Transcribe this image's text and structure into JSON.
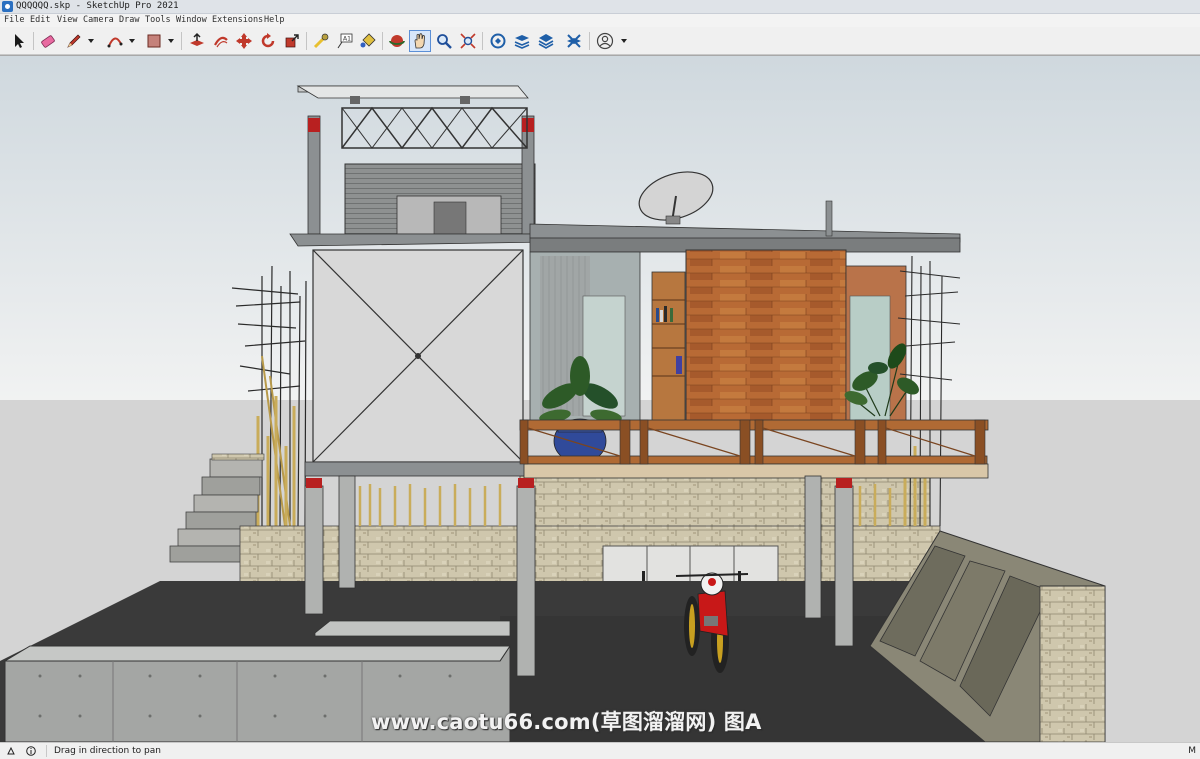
{
  "window": {
    "title": "QQQQQQ.skp - SketchUp Pro 2021"
  },
  "menu": [
    "File",
    "Edit",
    "View",
    "Camera",
    "Draw",
    "Tools",
    "Window",
    "Extensions",
    "Help"
  ],
  "toolbar": {
    "tools": [
      {
        "name": "select-tool"
      },
      {
        "name": "eraser-tool"
      },
      {
        "name": "line-tool",
        "dropdown": true
      },
      {
        "name": "arc-tool",
        "dropdown": true
      },
      {
        "name": "rectangle-tool",
        "dropdown": true
      },
      {
        "name": "push-pull-tool"
      },
      {
        "name": "offset-tool"
      },
      {
        "name": "move-tool"
      },
      {
        "name": "rotate-tool"
      },
      {
        "name": "scale-tool"
      },
      {
        "name": "tape-measure-tool"
      },
      {
        "name": "text-tool"
      },
      {
        "name": "paint-bucket-tool"
      },
      {
        "name": "orbit-tool"
      },
      {
        "name": "pan-tool",
        "active": true
      },
      {
        "name": "zoom-tool"
      },
      {
        "name": "zoom-extents-tool"
      },
      {
        "name": "warehouse-tool"
      },
      {
        "name": "extension-warehouse-tool"
      },
      {
        "name": "layout-send-tool"
      },
      {
        "name": "extension-manager-tool"
      },
      {
        "name": "account-tool",
        "dropdown": true
      }
    ]
  },
  "viewport": {
    "watermark": "www.caotu66.com(草图溜溜网) 图A",
    "colors": {
      "sky_top": "#cfd8de",
      "sky_bottom": "#f1f2f2",
      "ground": "#d4d4d4",
      "wood": "#b86a35",
      "stone": "#cfc7ad",
      "steel": "#8c9092"
    }
  },
  "status": {
    "hint": "Drag in direction to pan",
    "measure_label": "M"
  }
}
